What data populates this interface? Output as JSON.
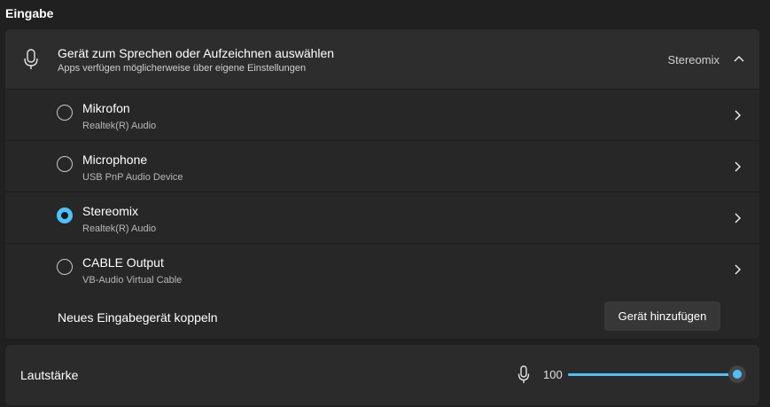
{
  "section_title": "Eingabe",
  "input_device": {
    "title": "Gerät zum Sprechen oder Aufzeichnen auswählen",
    "subtitle": "Apps verfügen möglicherweise über eigene Einstellungen",
    "selected_value": "Stereomix",
    "icon": "microphone-icon",
    "expanded": true
  },
  "devices": [
    {
      "name": "Mikrofon",
      "sub": "Realtek(R) Audio",
      "selected": false
    },
    {
      "name": "Microphone",
      "sub": "USB PnP Audio Device",
      "selected": false
    },
    {
      "name": "Stereomix",
      "sub": "Realtek(R) Audio",
      "selected": true
    },
    {
      "name": "CABLE Output",
      "sub": "VB-Audio Virtual Cable",
      "selected": false
    }
  ],
  "pair": {
    "label": "Neues Eingabegerät koppeln",
    "button_label": "Gerät hinzufügen"
  },
  "volume": {
    "label": "Lautstärke",
    "value": "100",
    "level_percent": 100,
    "icon": "microphone-icon"
  },
  "colors": {
    "accent": "#4cc2ff",
    "background": "#202020",
    "panel": "#2b2b2b"
  }
}
